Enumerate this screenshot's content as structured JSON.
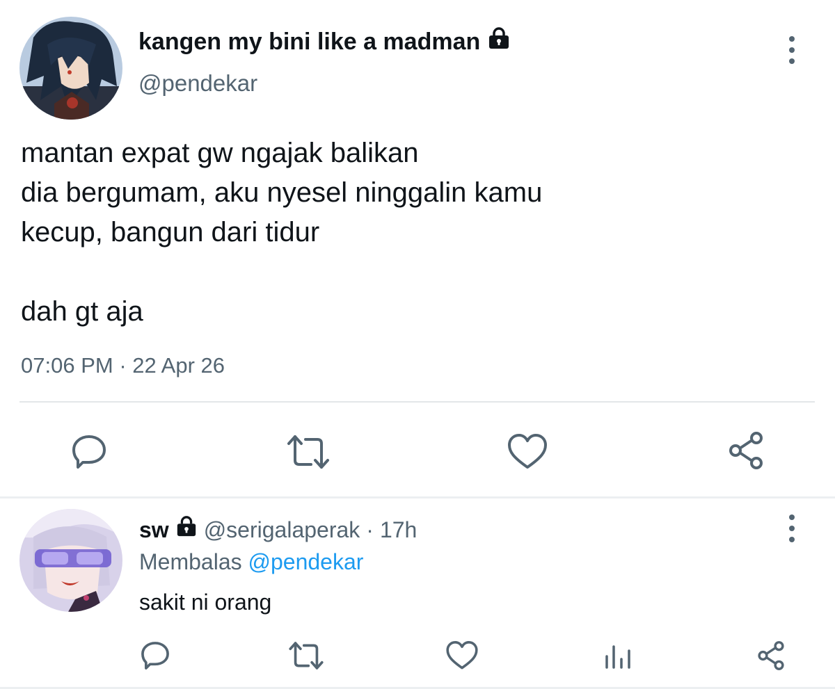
{
  "tweet": {
    "author_name": "kangen my bini like a madman",
    "author_handle": "@pendekar",
    "locked": true,
    "text_lines": [
      "mantan expat gw ngajak balikan",
      "dia bergumam, aku nyesel ninggalin kamu",
      "kecup, bangun dari tidur",
      "",
      "dah gt aja"
    ],
    "time": "07:06 PM",
    "separator": "·",
    "date": "22 Apr 26",
    "actions": [
      "reply-icon",
      "retweet-icon",
      "like-icon",
      "share-icon"
    ]
  },
  "reply": {
    "author_name": "sw",
    "locked": true,
    "author_handle": "@serigalaperak",
    "separator": "·",
    "age": "17h",
    "replying_to_label": "Membalas",
    "replying_to_handle": "@pendekar",
    "text": "sakit ni orang",
    "actions": [
      "reply-icon",
      "retweet-icon",
      "like-icon",
      "analytics-icon",
      "share-icon"
    ]
  },
  "colors": {
    "text": "#0f1419",
    "secondary": "#536471",
    "link": "#1d9bf0",
    "divider": "#e3e6e8"
  }
}
